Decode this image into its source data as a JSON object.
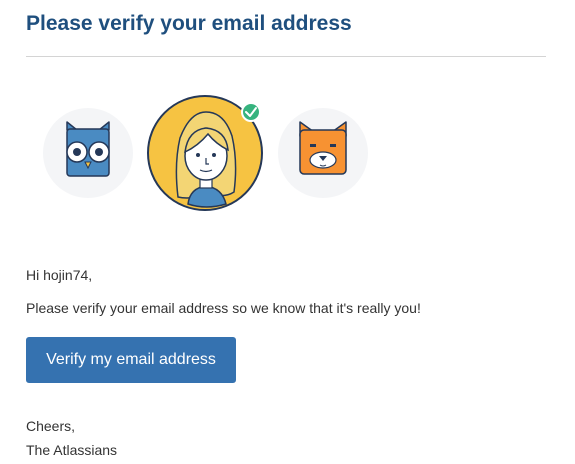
{
  "email": {
    "title": "Please verify your email address",
    "greeting": "Hi hojin74,",
    "message": "Please verify your email address so we know that it's really you!",
    "button_label": "Verify my email address",
    "signoff": "Cheers,",
    "signature": "The Atlassians"
  },
  "avatars": [
    {
      "icon": "owl-icon",
      "selected": false
    },
    {
      "icon": "woman-avatar-icon",
      "selected": true
    },
    {
      "icon": "cat-icon",
      "selected": false
    }
  ],
  "colors": {
    "title": "#1f4f7e",
    "button": "#3572b0",
    "avatar_bg": "#f4f5f7",
    "selected_bg": "#f6c342",
    "check": "#36b37e"
  }
}
